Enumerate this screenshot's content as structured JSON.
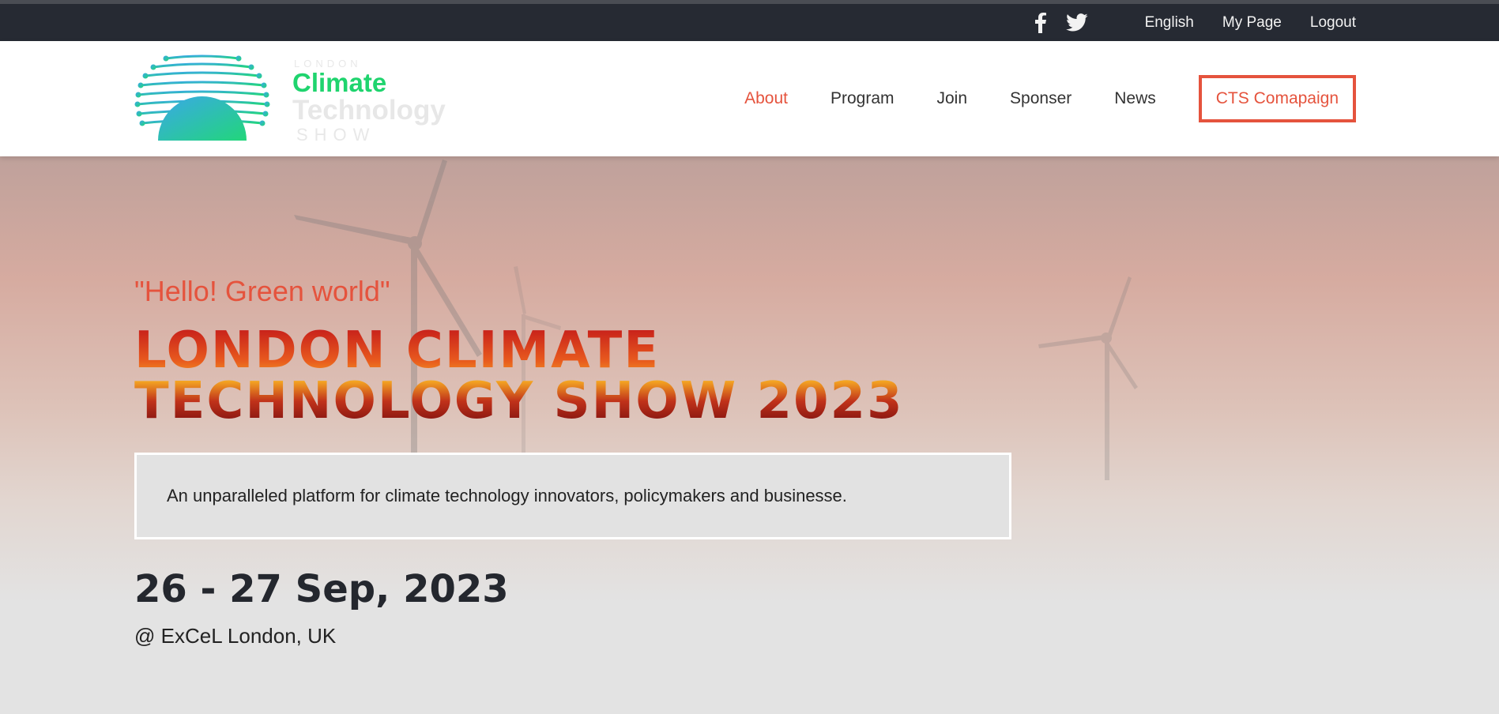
{
  "topbar": {
    "social": [
      {
        "icon": "facebook-icon"
      },
      {
        "icon": "twitter-icon"
      }
    ],
    "links": [
      "English",
      "My Page",
      "Logout"
    ]
  },
  "logo": {
    "line1": "LONDON",
    "line2": "Climate",
    "line3": "Technology",
    "line4": "SHOW"
  },
  "nav": {
    "items": [
      "About",
      "Program",
      "Join",
      "Sponser",
      "News"
    ],
    "active": "About",
    "cta": "CTS Comapaign"
  },
  "hero": {
    "tagline": "\"Hello! Green world\"",
    "headline_line1": "LONDON CLIMATE",
    "headline_line2": "TECHNOLOGY SHOW 2023",
    "description": "An unparalleled platform for climate technology innovators, policymakers and businesse.",
    "date": "26 - 27 Sep, 2023",
    "venue": "@ ExCeL London, UK"
  },
  "colors": {
    "accent": "#e5533d",
    "topbar_bg": "#262a33",
    "logo_green": "#1fd46e"
  }
}
